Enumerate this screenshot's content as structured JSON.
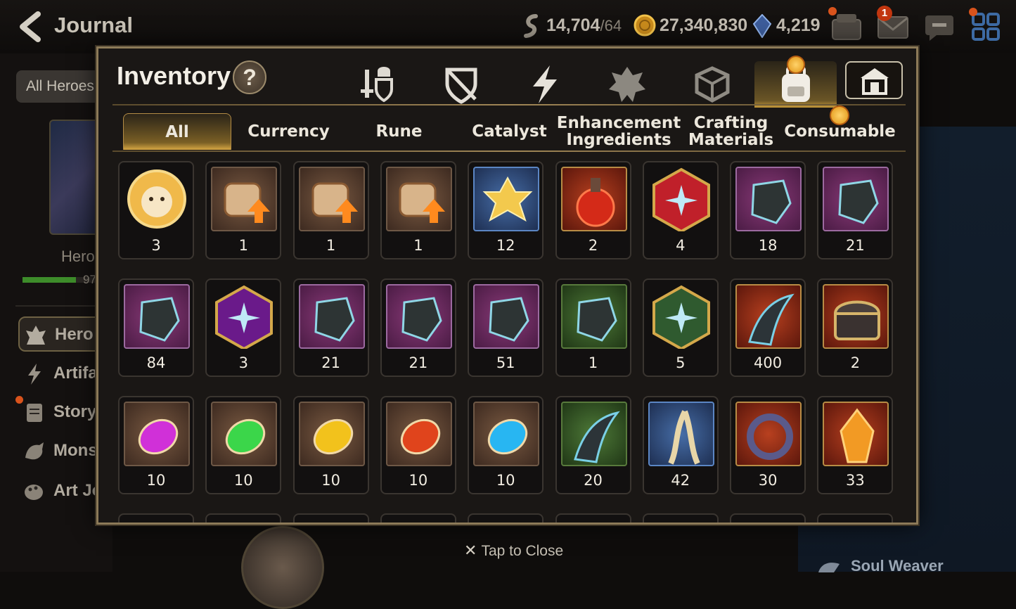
{
  "header": {
    "title": "Journal",
    "resources": [
      {
        "icon": "stamina-icon",
        "value": "14,704",
        "suffix": "/64"
      },
      {
        "icon": "gold-icon",
        "value": "27,340,830"
      },
      {
        "icon": "skystone-icon",
        "value": "4,219"
      }
    ],
    "mail_badge": "1"
  },
  "sidebar": {
    "filter_label": "All Heroes",
    "hero_label": "Hero",
    "hero_progress_text": "97",
    "items": [
      {
        "label": "Hero J",
        "icon": "hero-icon"
      },
      {
        "label": "Artifa",
        "icon": "artifact-icon"
      },
      {
        "label": "Story",
        "icon": "story-icon"
      },
      {
        "label": "Monst",
        "icon": "monster-icon"
      },
      {
        "label": "Art Jo",
        "icon": "art-icon"
      }
    ]
  },
  "right_panel": {
    "label": "Soul Weaver"
  },
  "footer": {
    "tap_close": "Tap to Close"
  },
  "modal": {
    "title": "Inventory",
    "help_label": "?",
    "category_icons": [
      "equipment-icon",
      "shield-icon",
      "lightning-icon",
      "rune-icon",
      "box-icon",
      "backpack-icon",
      "storage-icon"
    ],
    "active_category": "backpack-icon",
    "tabs": [
      {
        "label_line1": "All",
        "label_line2": ""
      },
      {
        "label_line1": "Currency",
        "label_line2": ""
      },
      {
        "label_line1": "Rune",
        "label_line2": ""
      },
      {
        "label_line1": "Catalyst",
        "label_line2": ""
      },
      {
        "label_line1": "Enhancement",
        "label_line2": "Ingredients"
      },
      {
        "label_line1": "Crafting",
        "label_line2": "Materials"
      },
      {
        "label_line1": "Consumable",
        "label_line2": ""
      }
    ],
    "active_tab": "All",
    "items": [
      {
        "name": "mascot-token",
        "count": "3"
      },
      {
        "name": "upgrade-scroll",
        "count": "1"
      },
      {
        "name": "rainbow-upgrade-scroll",
        "count": "1"
      },
      {
        "name": "dragon-upgrade-scroll",
        "count": "1"
      },
      {
        "name": "golden-crystal-flower",
        "count": "12"
      },
      {
        "name": "red-potion",
        "count": "2"
      },
      {
        "name": "red-star-rune",
        "count": "4"
      },
      {
        "name": "cyan-rune",
        "count": "18"
      },
      {
        "name": "cyan-armor-rune",
        "count": "21"
      },
      {
        "name": "hammer-rune",
        "count": "84"
      },
      {
        "name": "purple-star-rune",
        "count": "3"
      },
      {
        "name": "spiral-rune",
        "count": "21"
      },
      {
        "name": "sword-rune",
        "count": "21"
      },
      {
        "name": "exclamation-rune",
        "count": "51"
      },
      {
        "name": "white-sword-rune",
        "count": "1"
      },
      {
        "name": "green-star-rune",
        "count": "5"
      },
      {
        "name": "dark-claw-fragment",
        "count": "400"
      },
      {
        "name": "treasure-chest",
        "count": "2"
      },
      {
        "name": "pink-moon-gem",
        "count": "10"
      },
      {
        "name": "green-leaf-gem",
        "count": "10"
      },
      {
        "name": "yellow-sun-gem",
        "count": "10"
      },
      {
        "name": "red-flame-gem",
        "count": "10"
      },
      {
        "name": "blue-ice-gem",
        "count": "10"
      },
      {
        "name": "monster-claw",
        "count": "20"
      },
      {
        "name": "herb-root",
        "count": "42"
      },
      {
        "name": "spirit-ring",
        "count": "30"
      },
      {
        "name": "flame-crystal",
        "count": "33"
      }
    ]
  },
  "colors": {
    "accent_gold": "#c9a04a",
    "panel_border": "#8c7a58"
  }
}
